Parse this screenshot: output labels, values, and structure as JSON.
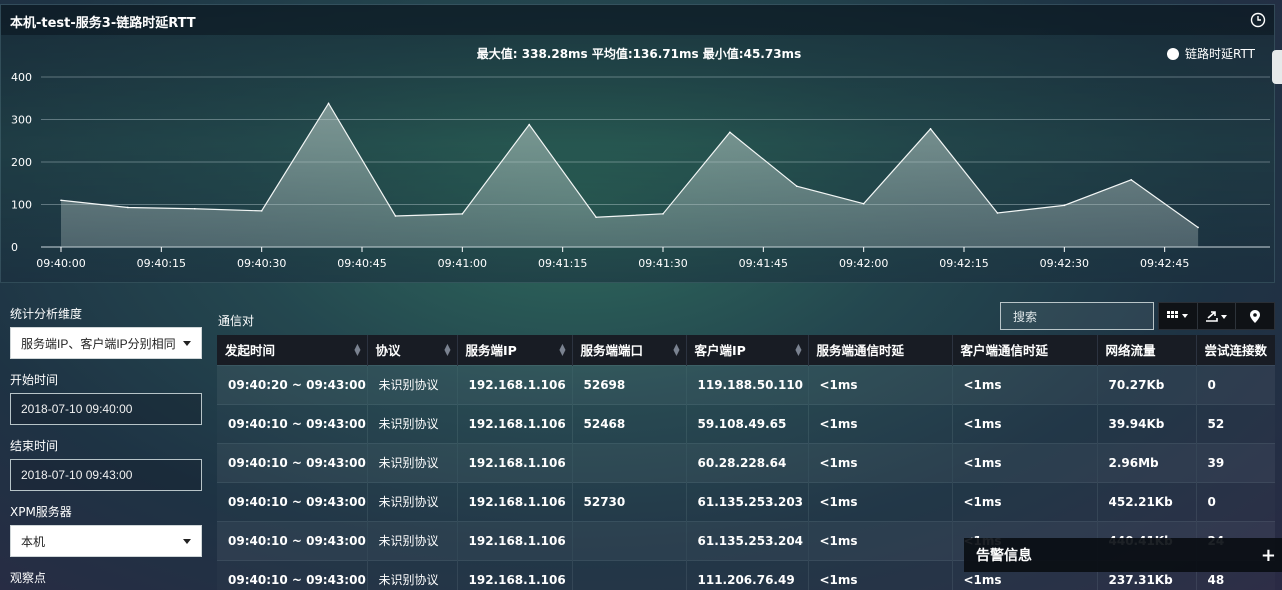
{
  "chart_panel": {
    "title": "本机-test-服务3-链路时延RTT",
    "stats_text": "最大值: 338.28ms 平均值:136.71ms 最小值:45.73ms",
    "legend_label": "链路时延RTT"
  },
  "chart_data": {
    "type": "area",
    "title": "本机-test-服务3-链路时延RTT",
    "xlabel": "",
    "ylabel": "",
    "ylim": [
      0,
      400
    ],
    "yticks": [
      0,
      100,
      200,
      300,
      400
    ],
    "xlim_seconds_from_start": [
      0,
      180
    ],
    "x_tick_labels": [
      "09:40:00",
      "09:40:15",
      "09:40:30",
      "09:40:45",
      "09:41:00",
      "09:41:15",
      "09:41:30",
      "09:41:45",
      "09:42:00",
      "09:42:15",
      "09:42:30",
      "09:42:45"
    ],
    "x": [
      "09:40:00",
      "09:40:10",
      "09:40:20",
      "09:40:30",
      "09:40:40",
      "09:40:50",
      "09:41:00",
      "09:41:10",
      "09:41:20",
      "09:41:30",
      "09:41:40",
      "09:41:50",
      "09:42:00",
      "09:42:10",
      "09:42:20",
      "09:42:30",
      "09:42:40",
      "09:42:50"
    ],
    "series": [
      {
        "name": "链路时延RTT",
        "values": [
          110,
          93,
          90,
          85,
          338,
          73,
          78,
          288,
          70,
          78,
          270,
          143,
          102,
          278,
          80,
          98,
          158,
          46
        ]
      }
    ],
    "grid": true,
    "legend": "top-right"
  },
  "filters": {
    "dimension_label": "统计分析维度",
    "dimension_value": "服务端IP、客户端IP分别相同",
    "start_label": "开始时间",
    "start_value": "2018-07-10 09:40:00",
    "end_label": "结束时间",
    "end_value": "2018-07-10 09:43:00",
    "server_label": "XPM服务器",
    "server_value": "本机",
    "observe_label": "观察点"
  },
  "table": {
    "title": "通信对",
    "search_placeholder": "搜索",
    "columns": [
      "发起时间",
      "协议",
      "服务端IP",
      "服务端端口",
      "客户端IP",
      "服务端通信时延",
      "客户端通信时延",
      "网络流量",
      "尝试连接数"
    ],
    "rows": [
      [
        "09:40:20 ~ 09:43:00",
        "未识别协议",
        "192.168.1.106",
        "52698",
        "119.188.50.110",
        "<1ms",
        "<1ms",
        "70.27Kb",
        "0"
      ],
      [
        "09:40:10 ~ 09:43:00",
        "未识别协议",
        "192.168.1.106",
        "52468",
        "59.108.49.65",
        "<1ms",
        "<1ms",
        "39.94Kb",
        "52"
      ],
      [
        "09:40:10 ~ 09:43:00",
        "未识别协议",
        "192.168.1.106",
        "",
        "60.28.228.64",
        "<1ms",
        "<1ms",
        "2.96Mb",
        "39"
      ],
      [
        "09:40:10 ~ 09:43:00",
        "未识别协议",
        "192.168.1.106",
        "52730",
        "61.135.253.203",
        "<1ms",
        "<1ms",
        "452.21Kb",
        "0"
      ],
      [
        "09:40:10 ~ 09:43:00",
        "未识别协议",
        "192.168.1.106",
        "",
        "61.135.253.204",
        "<1ms",
        "<1ms",
        "440.41Kb",
        "24"
      ],
      [
        "09:40:10 ~ 09:43:00",
        "未识别协议",
        "192.168.1.106",
        "",
        "111.206.76.49",
        "<1ms",
        "<1ms",
        "237.31Kb",
        "48"
      ]
    ]
  },
  "alert": {
    "title": "告警信息"
  }
}
